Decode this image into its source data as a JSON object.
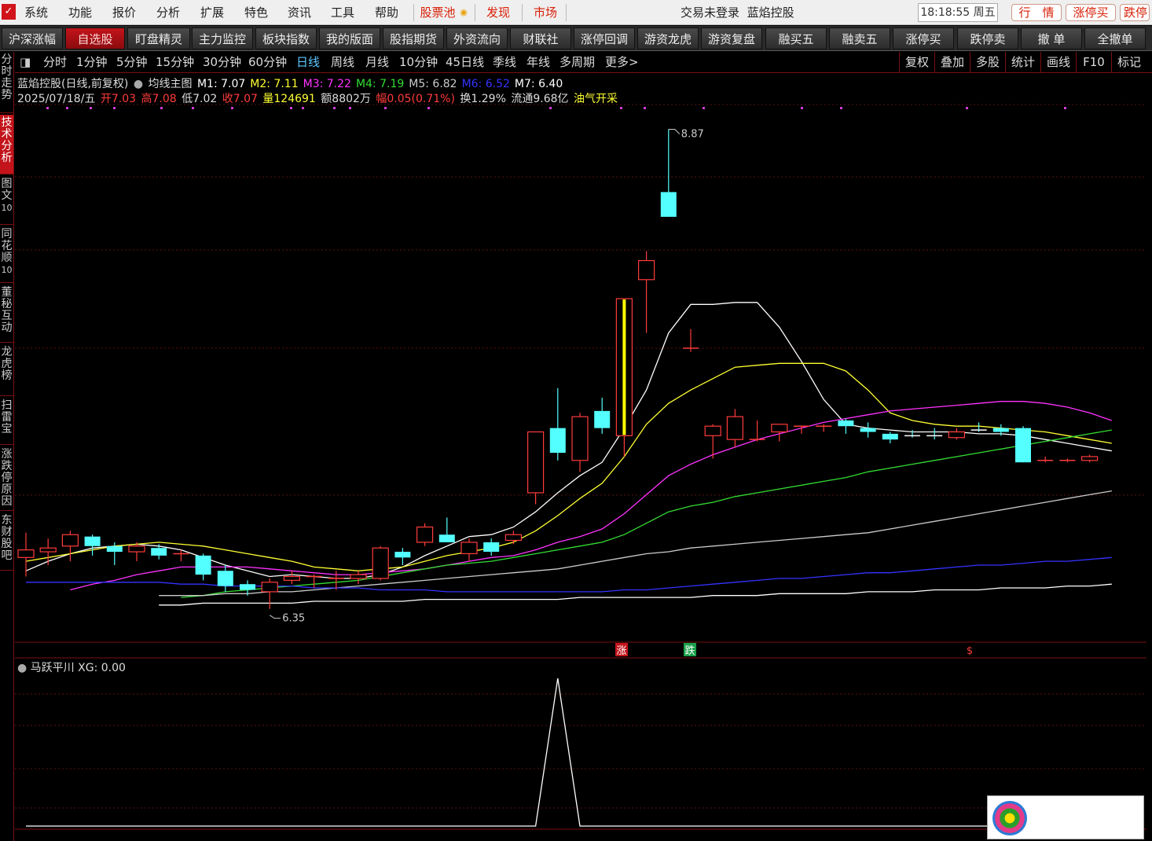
{
  "menu": {
    "logo": "✓",
    "items": [
      "系统",
      "功能",
      "报价",
      "分析",
      "扩展",
      "特色",
      "资讯",
      "工具",
      "帮助"
    ],
    "special": [
      "股票池",
      "发现",
      "市场"
    ],
    "login_status": "交易未登录",
    "stock_title": "蓝焰控股",
    "time": "18:18:55 周五",
    "right_buttons": [
      "行　情",
      "涨停买",
      "跌停"
    ]
  },
  "toolbar": {
    "buttons": [
      "沪深涨幅",
      "自选股",
      "盯盘精灵",
      "主力监控",
      "板块指数",
      "我的版面",
      "股指期货",
      "外资流向",
      "财联社",
      "涨停回调",
      "游资龙虎",
      "游资复盘",
      "融买五",
      "融卖五",
      "涨停买",
      "跌停卖",
      "撤 单",
      "全撤单"
    ],
    "active_index": 1
  },
  "sidebar": {
    "tabs": [
      {
        "label": "分时走势",
        "num": ""
      },
      {
        "label": "技术分析",
        "num": ""
      },
      {
        "label": "图文",
        "num": "10"
      },
      {
        "label": "同花顺",
        "num": "10"
      },
      {
        "label": "董秘互动",
        "num": ""
      },
      {
        "label": "龙虎榜",
        "num": ""
      },
      {
        "label": "扫雷宝",
        "num": ""
      },
      {
        "label": "涨跌停原因",
        "num": ""
      },
      {
        "label": "东财股吧",
        "num": ""
      }
    ],
    "active_index": 1
  },
  "periods": {
    "items": [
      "分时",
      "1分钟",
      "5分钟",
      "15分钟",
      "30分钟",
      "60分钟",
      "日线",
      "周线",
      "月线",
      "10分钟",
      "45日线",
      "季线",
      "年线",
      "多周期",
      "更多>"
    ],
    "active": "日线",
    "right": [
      "复权",
      "叠加",
      "多股",
      "统计",
      "画线",
      "F10",
      "标记"
    ]
  },
  "info": {
    "title": "蓝焰控股(日线,前复权)",
    "indicator": "均线主图",
    "ma": [
      {
        "label": "M1: 7.07",
        "color": "#ffffff"
      },
      {
        "label": "M2: 7.11",
        "color": "#ffff33"
      },
      {
        "label": "M3: 7.22",
        "color": "#ff33ff"
      },
      {
        "label": "M4: 7.19",
        "color": "#33dd33"
      },
      {
        "label": "M5: 6.82",
        "color": "#cccccc"
      },
      {
        "label": "M6: 6.52",
        "color": "#3333ff"
      },
      {
        "label": "M7: 6.40",
        "color": "#ffffff"
      }
    ],
    "date": "2025/07/18/五",
    "open": "开7.03",
    "high": "高7.08",
    "low": "低7.02",
    "close": "收7.07",
    "volume": "量124691",
    "amount": "额8802万",
    "change": "幅0.05(0.71%)",
    "turnover": "换1.29%",
    "float": "流通9.68亿",
    "concept": "油气开采"
  },
  "chart_data": {
    "type": "candlestick",
    "ylim": [
      6.2,
      9.0
    ],
    "high_label": "8.87",
    "low_label": "6.35",
    "markers": [
      "涨",
      "跌",
      "$"
    ],
    "candles": [
      {
        "o": 6.62,
        "h": 6.75,
        "l": 6.52,
        "c": 6.66
      },
      {
        "o": 6.65,
        "h": 6.72,
        "l": 6.58,
        "c": 6.67
      },
      {
        "o": 6.68,
        "h": 6.76,
        "l": 6.6,
        "c": 6.74
      },
      {
        "o": 6.73,
        "h": 6.74,
        "l": 6.63,
        "c": 6.68
      },
      {
        "o": 6.68,
        "h": 6.7,
        "l": 6.58,
        "c": 6.65
      },
      {
        "o": 6.65,
        "h": 6.7,
        "l": 6.6,
        "c": 6.68
      },
      {
        "o": 6.67,
        "h": 6.69,
        "l": 6.61,
        "c": 6.63
      },
      {
        "o": 6.64,
        "h": 6.66,
        "l": 6.6,
        "c": 6.64
      },
      {
        "o": 6.63,
        "h": 6.64,
        "l": 6.5,
        "c": 6.53
      },
      {
        "o": 6.55,
        "h": 6.58,
        "l": 6.44,
        "c": 6.47
      },
      {
        "o": 6.48,
        "h": 6.5,
        "l": 6.42,
        "c": 6.45
      },
      {
        "o": 6.44,
        "h": 6.51,
        "l": 6.35,
        "c": 6.49
      },
      {
        "o": 6.5,
        "h": 6.55,
        "l": 6.48,
        "c": 6.52
      },
      {
        "o": 6.52,
        "h": 6.53,
        "l": 6.46,
        "c": 6.52
      },
      {
        "o": 6.5,
        "h": 6.55,
        "l": 6.45,
        "c": 6.51
      },
      {
        "o": 6.51,
        "h": 6.55,
        "l": 6.48,
        "c": 6.53
      },
      {
        "o": 6.51,
        "h": 6.68,
        "l": 6.5,
        "c": 6.67
      },
      {
        "o": 6.65,
        "h": 6.67,
        "l": 6.58,
        "c": 6.62
      },
      {
        "o": 6.7,
        "h": 6.8,
        "l": 6.68,
        "c": 6.78
      },
      {
        "o": 6.74,
        "h": 6.83,
        "l": 6.7,
        "c": 6.7
      },
      {
        "o": 6.64,
        "h": 6.72,
        "l": 6.6,
        "c": 6.7
      },
      {
        "o": 6.7,
        "h": 6.72,
        "l": 6.63,
        "c": 6.65
      },
      {
        "o": 6.71,
        "h": 6.76,
        "l": 6.69,
        "c": 6.74
      },
      {
        "o": 6.96,
        "h": 7.28,
        "l": 6.9,
        "c": 7.28
      },
      {
        "o": 7.3,
        "h": 7.51,
        "l": 7.13,
        "c": 7.17
      },
      {
        "o": 7.13,
        "h": 7.38,
        "l": 7.07,
        "c": 7.36
      },
      {
        "o": 7.39,
        "h": 7.46,
        "l": 7.27,
        "c": 7.3
      },
      {
        "o": 7.26,
        "h": 7.98,
        "l": 7.15,
        "c": 7.98
      },
      {
        "o": 8.08,
        "h": 8.23,
        "l": 7.8,
        "c": 8.18
      },
      {
        "o": 8.54,
        "h": 8.87,
        "l": 8.43,
        "c": 8.41
      },
      {
        "o": 7.72,
        "h": 7.82,
        "l": 7.7,
        "c": 7.72
      },
      {
        "o": 7.26,
        "h": 7.32,
        "l": 7.14,
        "c": 7.31
      },
      {
        "o": 7.24,
        "h": 7.4,
        "l": 7.2,
        "c": 7.36
      },
      {
        "o": 7.23,
        "h": 7.34,
        "l": 7.23,
        "c": 7.24
      },
      {
        "o": 7.28,
        "h": 7.29,
        "l": 7.23,
        "c": 7.32
      },
      {
        "o": 7.31,
        "h": 7.31,
        "l": 7.27,
        "c": 7.31
      },
      {
        "o": 7.3,
        "h": 7.32,
        "l": 7.28,
        "c": 7.31
      },
      {
        "o": 7.34,
        "h": 7.35,
        "l": 7.27,
        "c": 7.31
      },
      {
        "o": 7.3,
        "h": 7.33,
        "l": 7.25,
        "c": 7.28
      },
      {
        "o": 7.27,
        "h": 7.28,
        "l": 7.22,
        "c": 7.24
      },
      {
        "o": 7.27,
        "h": 7.29,
        "l": 7.25,
        "c": 7.26
      },
      {
        "o": 7.27,
        "h": 7.3,
        "l": 7.24,
        "c": 7.26
      },
      {
        "o": 7.25,
        "h": 7.3,
        "l": 7.24,
        "c": 7.28
      },
      {
        "o": 7.3,
        "h": 7.33,
        "l": 7.28,
        "c": 7.29
      },
      {
        "o": 7.3,
        "h": 7.32,
        "l": 7.26,
        "c": 7.28
      },
      {
        "o": 7.3,
        "h": 7.31,
        "l": 7.12,
        "c": 7.12
      },
      {
        "o": 7.12,
        "h": 7.15,
        "l": 7.12,
        "c": 7.13
      },
      {
        "o": 7.13,
        "h": 7.14,
        "l": 7.12,
        "c": 7.13
      },
      {
        "o": 7.13,
        "h": 7.16,
        "l": 7.12,
        "c": 7.15
      }
    ],
    "ma_series": [
      {
        "name": "M1",
        "color": "#ffffff",
        "values": [
          6.55,
          6.6,
          6.64,
          6.67,
          6.68,
          6.69,
          6.68,
          6.66,
          6.62,
          6.58,
          6.55,
          6.52,
          6.53,
          6.52,
          6.51,
          6.51,
          6.53,
          6.57,
          6.63,
          6.68,
          6.73,
          6.74,
          6.78,
          6.86,
          6.96,
          7.05,
          7.12,
          7.3,
          7.5,
          7.8,
          7.95,
          7.95,
          7.96,
          7.96,
          7.83,
          7.65,
          7.45,
          7.32,
          7.3,
          7.29,
          7.28,
          7.28,
          7.28,
          7.27,
          7.27,
          7.26,
          7.24,
          7.22,
          7.2,
          7.18
        ]
      },
      {
        "name": "M2",
        "color": "#ffff33",
        "values": [
          6.6,
          6.62,
          6.64,
          6.66,
          6.68,
          6.69,
          6.7,
          6.69,
          6.68,
          6.66,
          6.64,
          6.62,
          6.6,
          6.57,
          6.56,
          6.55,
          6.56,
          6.57,
          6.6,
          6.63,
          6.65,
          6.67,
          6.7,
          6.76,
          6.84,
          6.93,
          7.01,
          7.15,
          7.32,
          7.43,
          7.5,
          7.56,
          7.62,
          7.63,
          7.64,
          7.64,
          7.64,
          7.6,
          7.5,
          7.38,
          7.34,
          7.32,
          7.31,
          7.31,
          7.3,
          7.29,
          7.28,
          7.26,
          7.24,
          7.22
        ]
      },
      {
        "name": "M3",
        "color": "#ff33ff",
        "values": [
          null,
          null,
          6.45,
          6.48,
          6.5,
          6.53,
          6.55,
          6.57,
          6.57,
          6.57,
          6.57,
          6.56,
          6.55,
          6.54,
          6.53,
          6.53,
          6.54,
          6.55,
          6.56,
          6.58,
          6.6,
          6.62,
          6.63,
          6.66,
          6.7,
          6.73,
          6.77,
          6.85,
          6.95,
          7.05,
          7.11,
          7.16,
          7.2,
          7.24,
          7.27,
          7.3,
          7.33,
          7.35,
          7.37,
          7.39,
          7.4,
          7.41,
          7.42,
          7.43,
          7.44,
          7.44,
          7.43,
          7.41,
          7.38,
          7.34
        ]
      },
      {
        "name": "M4",
        "color": "#33dd33",
        "values": [
          null,
          null,
          null,
          null,
          null,
          null,
          null,
          6.41,
          6.42,
          6.44,
          6.45,
          6.46,
          6.47,
          6.48,
          6.49,
          6.5,
          6.52,
          6.54,
          6.56,
          6.58,
          6.59,
          6.6,
          6.62,
          6.64,
          6.66,
          6.68,
          6.7,
          6.74,
          6.8,
          6.86,
          6.89,
          6.91,
          6.94,
          6.96,
          6.98,
          7.0,
          7.02,
          7.04,
          7.07,
          7.09,
          7.11,
          7.13,
          7.15,
          7.17,
          7.19,
          7.21,
          7.23,
          7.25,
          7.27,
          7.29
        ]
      },
      {
        "name": "M5",
        "color": "#cccccc",
        "values": [
          null,
          null,
          null,
          null,
          null,
          null,
          6.42,
          6.42,
          6.42,
          6.43,
          6.43,
          6.44,
          6.44,
          6.45,
          6.46,
          6.47,
          6.48,
          6.49,
          6.5,
          6.51,
          6.52,
          6.53,
          6.54,
          6.55,
          6.56,
          6.58,
          6.6,
          6.62,
          6.64,
          6.65,
          6.67,
          6.68,
          6.69,
          6.7,
          6.71,
          6.72,
          6.73,
          6.74,
          6.75,
          6.77,
          6.79,
          6.81,
          6.83,
          6.85,
          6.87,
          6.89,
          6.91,
          6.93,
          6.95,
          6.97
        ]
      },
      {
        "name": "M6",
        "color": "#3333ff",
        "values": [
          6.49,
          6.49,
          6.49,
          6.49,
          6.49,
          6.49,
          6.49,
          6.48,
          6.48,
          6.47,
          6.47,
          6.47,
          6.47,
          6.46,
          6.46,
          6.46,
          6.45,
          6.45,
          6.45,
          6.44,
          6.44,
          6.44,
          6.44,
          6.44,
          6.44,
          6.44,
          6.44,
          6.45,
          6.45,
          6.46,
          6.47,
          6.48,
          6.49,
          6.5,
          6.51,
          6.51,
          6.52,
          6.53,
          6.54,
          6.54,
          6.55,
          6.56,
          6.57,
          6.58,
          6.58,
          6.59,
          6.6,
          6.6,
          6.61,
          6.62
        ]
      },
      {
        "name": "M7",
        "color": "#ffffff",
        "values": [
          null,
          null,
          null,
          null,
          null,
          null,
          6.37,
          6.37,
          6.38,
          6.38,
          6.38,
          6.38,
          6.38,
          6.39,
          6.39,
          6.39,
          6.39,
          6.39,
          6.4,
          6.4,
          6.4,
          6.4,
          6.4,
          6.4,
          6.4,
          6.41,
          6.41,
          6.41,
          6.41,
          6.41,
          6.41,
          6.42,
          6.42,
          6.42,
          6.43,
          6.43,
          6.43,
          6.43,
          6.44,
          6.44,
          6.44,
          6.45,
          6.45,
          6.45,
          6.46,
          6.46,
          6.46,
          6.47,
          6.47,
          6.48
        ]
      }
    ],
    "sub_indicator": {
      "title": "马跃平川",
      "label": "XG: 0.00",
      "values": [
        0,
        0,
        0,
        0,
        0,
        0,
        0,
        0,
        0,
        0,
        0,
        0,
        0,
        0,
        0,
        0,
        0,
        0,
        0,
        0,
        0,
        0,
        0,
        0,
        1,
        0,
        0,
        0,
        0,
        0,
        0,
        0,
        0,
        0,
        0,
        0,
        0,
        0,
        0,
        0,
        0,
        0,
        0,
        0,
        0,
        0,
        0,
        0,
        0,
        0
      ]
    }
  }
}
